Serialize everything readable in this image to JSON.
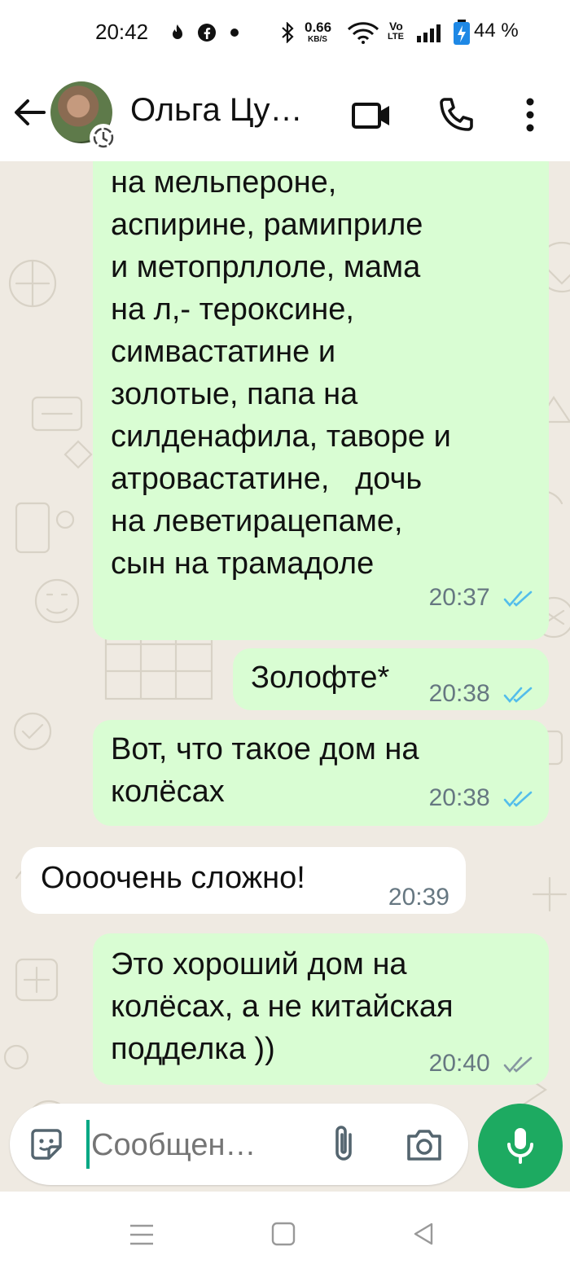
{
  "status_bar": {
    "time": "20:42",
    "left_icons": [
      "flame-icon",
      "facebook-icon",
      "dot-icon"
    ],
    "speed_value": "0.66",
    "speed_unit": "KB/S",
    "volte_top": "Vo",
    "volte_bottom": "LTE",
    "battery_percent": "44 %"
  },
  "header": {
    "contact_name": "Ольга Цу…",
    "icons": [
      "back-arrow-icon",
      "video-call-icon",
      "voice-call-icon",
      "more-vert-icon"
    ]
  },
  "messages": [
    {
      "direction": "outgoing",
      "text": "на мельпероне,\nаспирине, рамиприле\nи метопрллоле, мама\nна л,- тероксине,\nсимвастатине и\nзолотые, папа на\nсилденафила, таворе и\nатровастатине,   дочь\nна леветирацепаме,\nсын на трамадоле",
      "time": "20:37",
      "status": "read"
    },
    {
      "direction": "outgoing",
      "text": "Золофте*",
      "time": "20:38",
      "status": "read"
    },
    {
      "direction": "outgoing",
      "text": "Вот, что такое дом на\nколёсах",
      "time": "20:38",
      "status": "read"
    },
    {
      "direction": "incoming",
      "text": "Оооочень сложно!",
      "time": "20:39"
    },
    {
      "direction": "outgoing",
      "text": "Это хороший дом на\nколёсах, а не китайская\nподделка ))",
      "time": "20:40",
      "status": "delivered"
    }
  ],
  "composer": {
    "placeholder": "Сообщен…",
    "value": ""
  },
  "colors": {
    "chat_background": "#efeae2",
    "outgoing_bubble": "#d9fdd3",
    "incoming_bubble": "#ffffff",
    "read_ticks": "#53bdeb",
    "delivered_ticks": "#8696a0",
    "accent": "#1daa61"
  }
}
